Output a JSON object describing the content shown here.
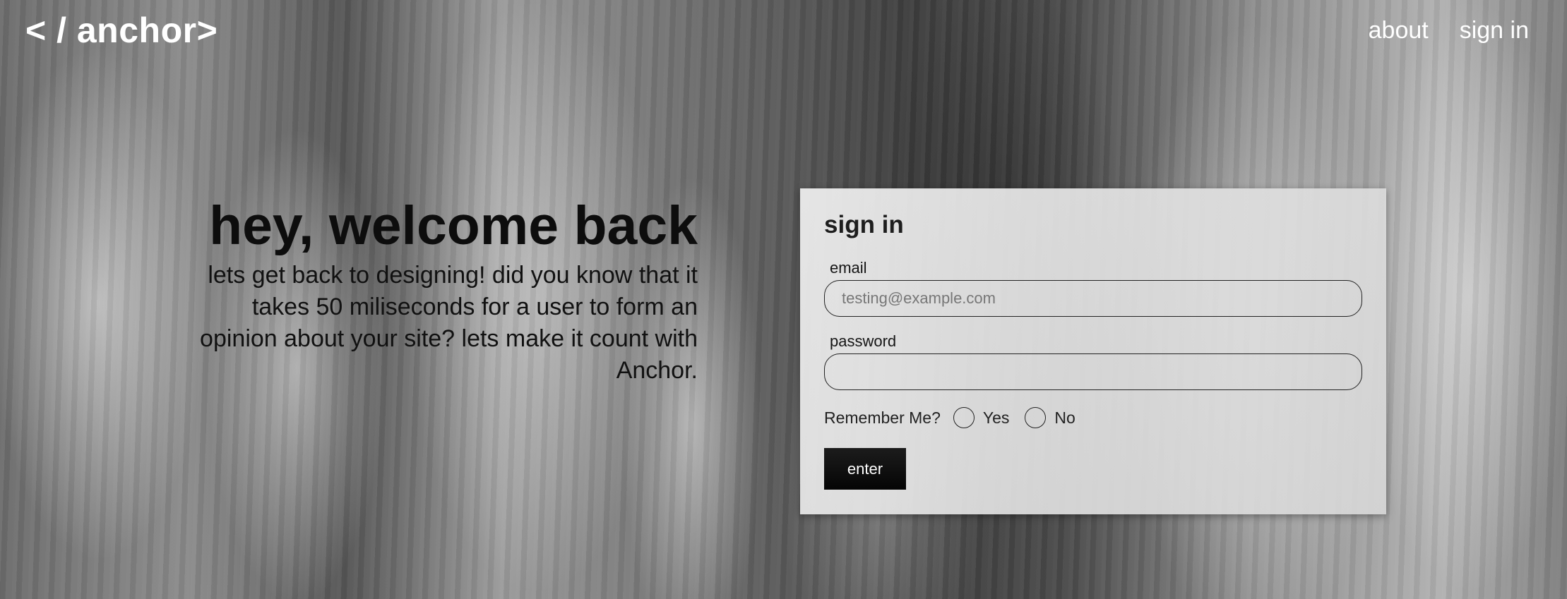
{
  "header": {
    "logo": "< / anchor>",
    "nav": {
      "about": "about",
      "sign_in": "sign in"
    }
  },
  "hero": {
    "title": "hey, welcome back",
    "subtitle": "lets get back to designing! did you know that it takes 50 miliseconds for a user to form an opinion about your site? lets make it count with Anchor."
  },
  "signin_form": {
    "title": "sign in",
    "email_label": "email",
    "email_placeholder": "testing@example.com",
    "password_label": "password",
    "remember_label": "Remember Me?",
    "remember_yes": "Yes",
    "remember_no": "No",
    "submit_label": "enter"
  },
  "colors": {
    "button_bg": "#0d0d0d",
    "text_dark": "#0d0d0d",
    "header_text": "#ffffff"
  }
}
